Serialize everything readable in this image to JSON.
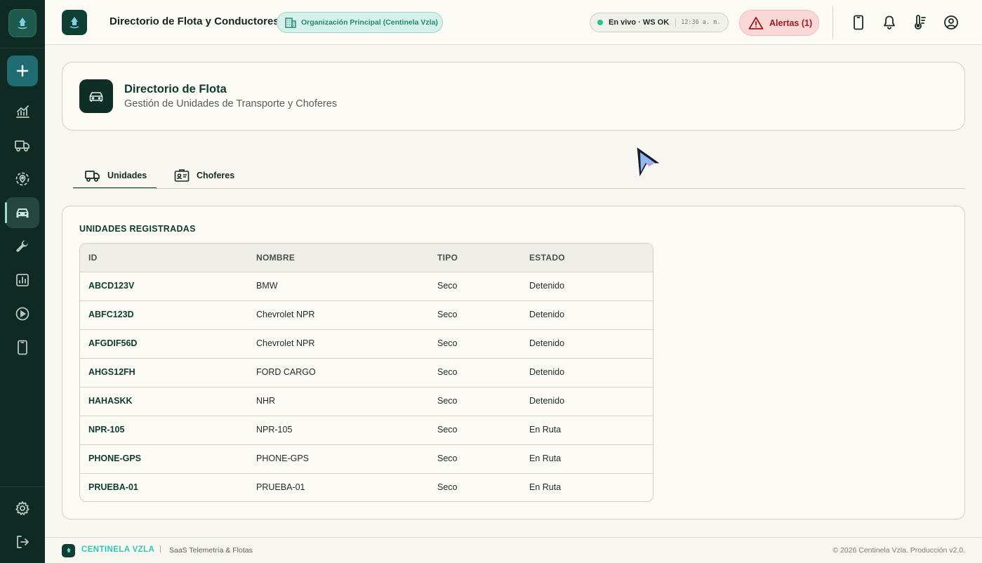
{
  "header": {
    "title": "Directorio de Flota y Conductores",
    "organization": "Organización Principal (Centinela Vzla)",
    "live_status": "En vivo · WS OK",
    "time": "12:36 a. m.",
    "alerts_label": "Alertas (1)"
  },
  "sidebar": {
    "items": [
      {
        "icon": "plus-icon"
      },
      {
        "icon": "analytics-icon"
      },
      {
        "icon": "truck-icon"
      },
      {
        "icon": "location-icon"
      },
      {
        "icon": "car-icon",
        "active": true
      },
      {
        "icon": "wrench-icon"
      },
      {
        "icon": "report-icon"
      },
      {
        "icon": "play-icon"
      },
      {
        "icon": "phone-icon"
      },
      {
        "icon": "gear-icon"
      },
      {
        "icon": "logout-icon"
      }
    ]
  },
  "page": {
    "title": "Directorio de Flota",
    "subtitle": "Gestión de Unidades de Transporte y Choferes"
  },
  "tabs": [
    {
      "label": "Unidades",
      "active": true
    },
    {
      "label": "Choferes",
      "active": false
    }
  ],
  "units": {
    "title": "UNIDADES REGISTRADAS",
    "columns": [
      "ID",
      "NOMBRE",
      "TIPO",
      "ESTADO"
    ],
    "rows": [
      [
        "ABCD123V",
        "BMW",
        "Seco",
        "Detenido"
      ],
      [
        "ABFC123D",
        "Chevrolet NPR",
        "Seco",
        "Detenido"
      ],
      [
        "AFGDIF56D",
        "Chevrolet NPR",
        "Seco",
        "Detenido"
      ],
      [
        "AHGS12FH",
        "FORD CARGO",
        "Seco",
        "Detenido"
      ],
      [
        "HAHASKK",
        "NHR",
        "Seco",
        "Detenido"
      ],
      [
        "NPR-105",
        "NPR-105",
        "Seco",
        "En Ruta"
      ],
      [
        "PHONE-GPS",
        "PHONE-GPS",
        "Seco",
        "En Ruta"
      ],
      [
        "PRUEBA-01",
        "PRUEBA-01",
        "Seco",
        "En Ruta"
      ]
    ]
  },
  "footer": {
    "brand": "CENTINELA VZLA",
    "separator": "|",
    "tagline": "SaaS Telemetría & Flotas",
    "copyright": "© 2026 Centinela Vzla. Producción v2.0."
  },
  "colors": {
    "sidebar": "#0f2a22",
    "accent": "#0f3b2e",
    "teal": "#2fc7b5",
    "alert": "#a3181f",
    "live": "#1ec48d"
  }
}
